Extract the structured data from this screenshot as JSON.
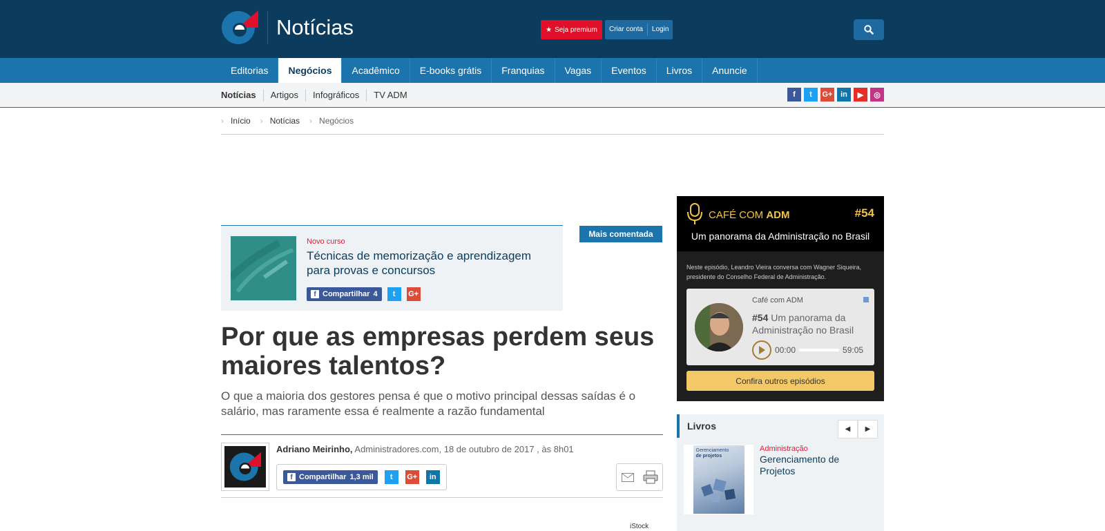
{
  "header": {
    "site_title": "Notícias",
    "premium_label": "Seja premium",
    "create_account_label": "Criar conta",
    "login_label": "Login"
  },
  "main_nav": {
    "items": [
      {
        "label": "Editorias",
        "active": false
      },
      {
        "label": "Negócios",
        "active": true
      },
      {
        "label": "Acadêmico",
        "active": false
      },
      {
        "label": "E-books grátis",
        "active": false
      },
      {
        "label": "Franquias",
        "active": false
      },
      {
        "label": "Vagas",
        "active": false
      },
      {
        "label": "Eventos",
        "active": false
      },
      {
        "label": "Livros",
        "active": false
      },
      {
        "label": "Anuncie",
        "active": false
      }
    ]
  },
  "sub_nav": {
    "items": [
      "Notícias",
      "Artigos",
      "Infográficos",
      "TV ADM"
    ]
  },
  "social": [
    {
      "icon": "facebook-icon",
      "glyph": "f",
      "color": "#3b5998"
    },
    {
      "icon": "twitter-icon",
      "glyph": "t",
      "color": "#1da1f2"
    },
    {
      "icon": "google-plus-icon",
      "glyph": "G+",
      "color": "#dd4b39"
    },
    {
      "icon": "linkedin-icon",
      "glyph": "in",
      "color": "#0e76a8"
    },
    {
      "icon": "youtube-icon",
      "glyph": "▶",
      "color": "#e52d27"
    },
    {
      "icon": "instagram-icon",
      "glyph": "◎",
      "color": "#c13584"
    }
  ],
  "breadcrumb": [
    "Início",
    "Notícias",
    "Negócios"
  ],
  "promo": {
    "label": "Novo curso",
    "title": "Técnicas de memorização e aprendizagem para provas e concursos",
    "share_label": "Compartilhar",
    "share_count": "4"
  },
  "badge": {
    "label": "Mais comentada"
  },
  "article": {
    "headline": "Por que as empresas perdem seus maiores talentos?",
    "subhead": "O que a maioria dos gestores pensa é que o motivo principal dessas saídas é o salário, mas raramente essa é realmente a razão fundamental",
    "author": "Adriano Meirinho,",
    "source_date": " Administradores.com, 18 de outubro de 2017 , às 8h01",
    "share_label": "Compartilhar",
    "share_count": "1,3 mil",
    "image_credit": "iStock"
  },
  "podcast": {
    "name_prefix": "CAFÉ COM ",
    "name_bold": "ADM",
    "episode": "#54",
    "title": "Um panorama da Administração no Brasil",
    "description": "Neste episódio, Leandro Vieira conversa com Wagner Siqueira, presidente do Conselho Federal de Administração.",
    "player_source": "Café com ADM",
    "player_episode": "#54",
    "player_title": " Um panorama da Administração no Brasil",
    "time_current": "00:00",
    "time_total": "59:05",
    "progress": 0,
    "more_button": "Confira outros episódios",
    "accent_color": "#f2c44e"
  },
  "livros": {
    "title": "Livros",
    "book_category": "Administração",
    "book_title": "Gerenciamento de Projetos",
    "cover_text_1": "Gerenciamento",
    "cover_text_2": "de projetos"
  }
}
